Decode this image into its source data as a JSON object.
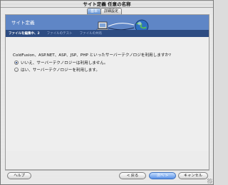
{
  "window": {
    "title": "サイト定義 任意の名称"
  },
  "tabs": [
    {
      "label": "基本",
      "active": true
    },
    {
      "label": "詳細設定",
      "active": false
    }
  ],
  "header": {
    "title": "サイト定義"
  },
  "steps": [
    {
      "label": "ファイルを編集中、2",
      "active": true
    },
    {
      "label": "ファイルのテスト",
      "active": false
    },
    {
      "label": "ファイルの共有",
      "active": false
    }
  ],
  "main": {
    "question": "ColdFusion、ASP.NET、ASP、JSP、PHP といったサーバーテクノロジを利用しますか?",
    "options": [
      {
        "label": "いいえ、サーバーテクノロジーは利用しません。",
        "checked": true
      },
      {
        "label": "はい、サーバーテクノロジーを利用します。",
        "checked": false
      }
    ]
  },
  "footer": {
    "help": "ヘルプ",
    "back": "< 戻る",
    "next": "次へ >",
    "cancel": "キャンセル"
  },
  "colors": {
    "header": "#5f86c6",
    "steps_bar": "#2d4c82",
    "primary_button": "#5a91e6"
  }
}
